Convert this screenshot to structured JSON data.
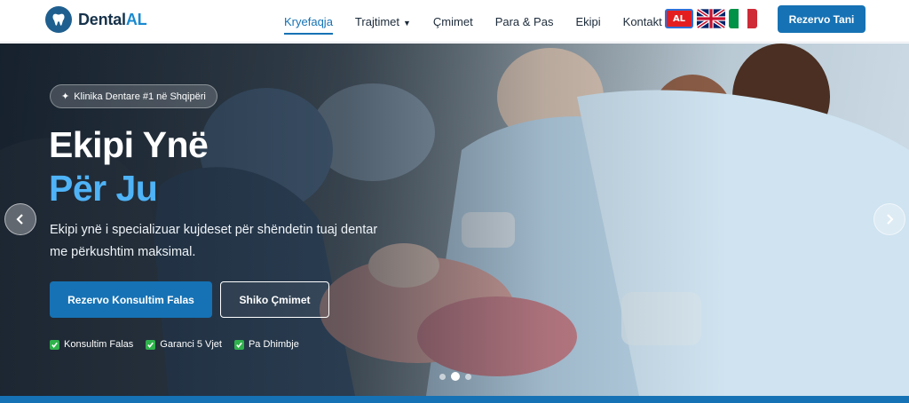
{
  "brand": {
    "name_main": "Dental",
    "name_accent": "AL",
    "color": "#1672b4"
  },
  "nav": {
    "items": [
      {
        "label": "Kryefaqja",
        "active": true
      },
      {
        "label": "Trajtimet",
        "has_dropdown": true
      },
      {
        "label": "Çmimet"
      },
      {
        "label": "Para & Pas"
      },
      {
        "label": "Ekipi"
      },
      {
        "label": "Kontakt"
      }
    ],
    "dropdown_caret": "▼"
  },
  "languages": {
    "current": "AL",
    "options": [
      {
        "code": "AL",
        "icon": "albania-flag-icon"
      },
      {
        "code": "EN",
        "icon": "uk-flag-icon"
      },
      {
        "code": "IT",
        "icon": "italy-flag-icon"
      }
    ]
  },
  "header_cta": "Rezervo Tani",
  "hero": {
    "badge": "Klinika Dentare #1 në Shqipëri",
    "badge_icon": "✦",
    "title_line1": "Ekipi Ynë",
    "title_line2": "Për Ju",
    "subtitle": "Ekipi ynë i specializuar kujdeset për shëndetin tuaj dentar me përkushtim maksimal.",
    "primary_button": "Rezervo Konsultim Falas",
    "secondary_button": "Shiko Çmimet",
    "features": [
      "Konsultim Falas",
      "Garanci 5 Vjet",
      "Pa Dhimbje"
    ],
    "slides_total": 3,
    "current_slide": 2
  },
  "colors": {
    "accent": "#1672b4",
    "title_highlight": "#4fb3f7",
    "check": "#2fb24c"
  }
}
